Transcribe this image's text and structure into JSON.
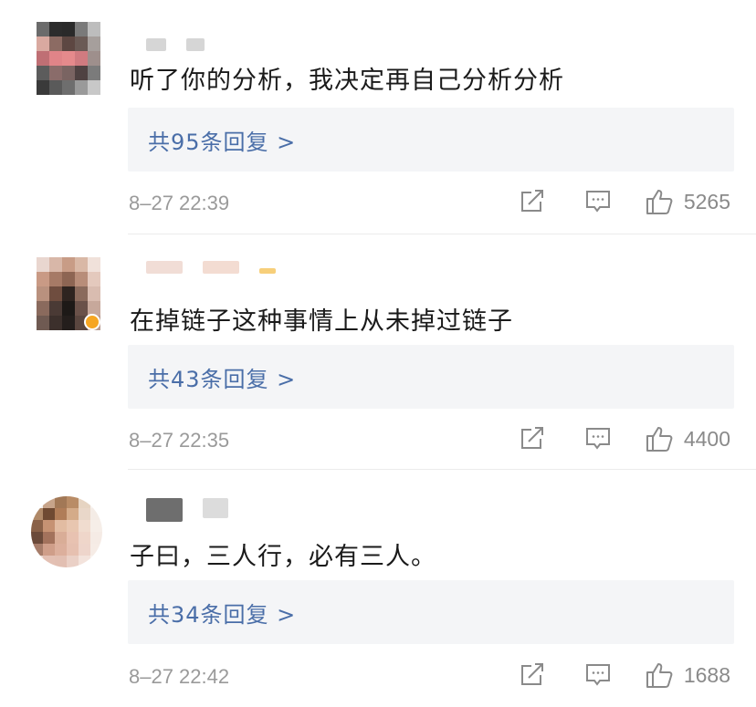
{
  "comments": [
    {
      "text": "听了你的分析，我决定再自己分析分析",
      "reply_label": "共95条回复 >",
      "time": "8–27 22:39",
      "likes": "5265"
    },
    {
      "text": "在掉链子这种事情上从未掉过链子",
      "reply_label": "共43条回复 >",
      "time": "8–27 22:35",
      "likes": "4400"
    },
    {
      "text": "子曰，三人行，必有三人。",
      "reply_label": "共34条回复 >",
      "time": "8–27 22:42",
      "likes": "1688"
    }
  ],
  "icons": {
    "share": "share-icon",
    "comment": "comment-icon",
    "like": "thumbs-up-icon"
  },
  "colors": {
    "reply_link": "#4a6ea8",
    "reply_bg": "#f4f5f7",
    "meta": "#9a9a9a"
  }
}
